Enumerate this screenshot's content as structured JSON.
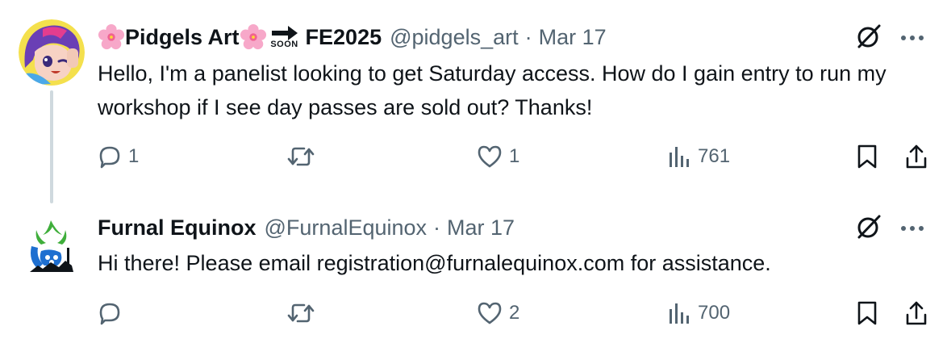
{
  "tweets": [
    {
      "author_name_prefix_emoji": "cherry-blossom",
      "author_name": "Pidgels Art",
      "author_name_suffix_emoji": "cherry-blossom",
      "soon_label": "SOON",
      "author_name_extra": "FE2025",
      "handle": "@pidgels_art",
      "separator": "·",
      "date": "Mar 17",
      "text": "Hello, I'm a panelist looking to get Saturday access. How do I gain entry to run my workshop if I see day passes are sold out? Thanks!",
      "reply_count": "1",
      "retweet_count": "",
      "like_count": "1",
      "view_count": "761"
    },
    {
      "author_name": "Furnal Equinox",
      "handle": "@FurnalEquinox",
      "separator": "·",
      "date": "Mar 17",
      "text": "Hi there! Please email registration@furnalequinox.com for assistance.",
      "reply_count": "",
      "retweet_count": "",
      "like_count": "2",
      "view_count": "700"
    }
  ],
  "colors": {
    "text": "#0f1419",
    "secondary": "#536471",
    "thread_line": "#cfd9de",
    "avatar_purple": "#6a3fb5",
    "logo_green": "#3fae3b",
    "logo_blue": "#1e6fd0"
  },
  "icons": [
    "cherry-blossom-emoji",
    "soon-arrow-emoji",
    "grok-icon",
    "more-icon",
    "reply-icon",
    "retweet-icon",
    "like-icon",
    "views-icon",
    "bookmark-icon",
    "share-icon"
  ]
}
